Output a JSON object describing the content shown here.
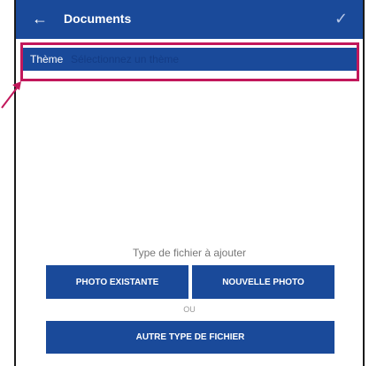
{
  "header": {
    "title": "Documents",
    "back_icon": "back-arrow-icon",
    "confirm_icon": "check-icon"
  },
  "theme": {
    "label": "Thème",
    "placeholder": "Sélectionnez un thème"
  },
  "upload": {
    "type_label": "Type de fichier à ajouter",
    "existing_photo_label": "PHOTO EXISTANTE",
    "new_photo_label": "NOUVELLE PHOTO",
    "or_label": "OU",
    "other_type_label": "AUTRE TYPE DE FICHIER"
  },
  "colors": {
    "accent": "#1a4a9a",
    "highlight": "#c2185b"
  }
}
